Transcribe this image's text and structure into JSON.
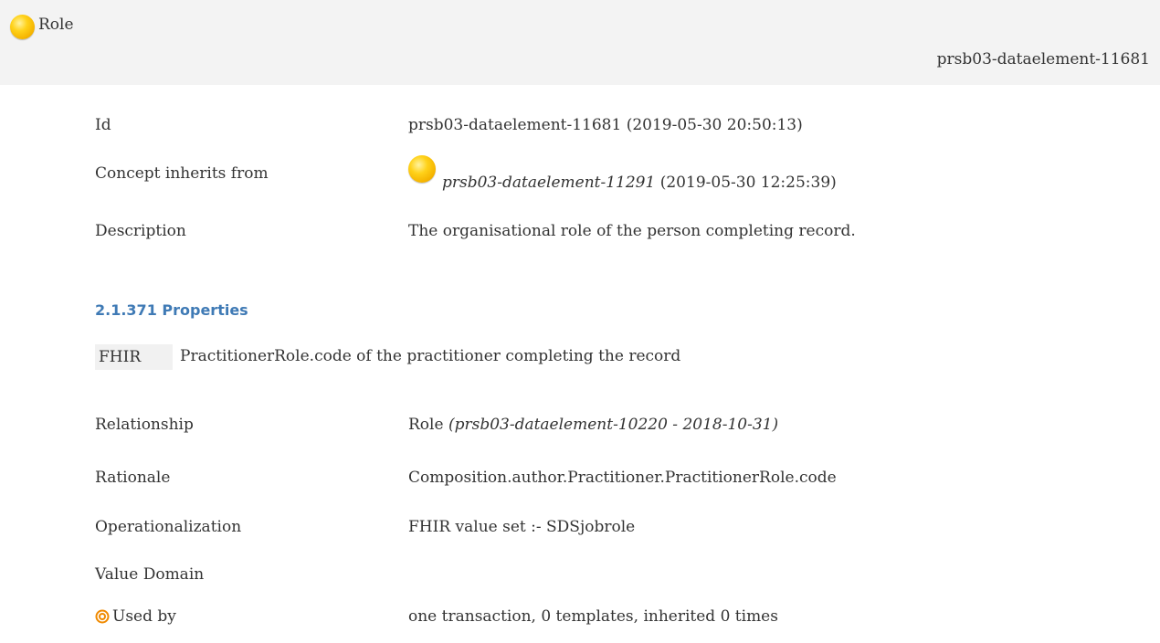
{
  "header": {
    "title": "Role",
    "id_right": "prsb03-dataelement-11681",
    "icon": "yellow-ball-icon"
  },
  "details": {
    "id_label": "Id",
    "id_value": "prsb03-dataelement-11681 (2019-05-30 20:50:13)",
    "inherits_label": "Concept inherits from",
    "inherits_link": "prsb03-dataelement-11291",
    "inherits_date": "(2019-05-30 12:25:39)",
    "description_label": "Description",
    "description_value": "The organisational role of the person completing record."
  },
  "properties": {
    "heading": "2.1.371 Properties",
    "fhir_badge": "FHIR",
    "fhir_text": "PractitionerRole.code of the practitioner completing the record",
    "relationship_label": "Relationship",
    "relationship_value": "Role",
    "relationship_ref": "(prsb03-dataelement-10220 - 2018-10-31)",
    "rationale_label": "Rationale",
    "rationale_value": "Composition.author.Practitioner.PractitionerRole.code",
    "operationalization_label": "Operationalization",
    "operationalization_value": "FHIR value set :- SDSjobrole",
    "value_domain_label": "Value Domain",
    "used_by_label": "Used by",
    "used_by_icon": "target-icon",
    "used_by_value": "one transaction, 0 templates, inherited 0 times"
  }
}
